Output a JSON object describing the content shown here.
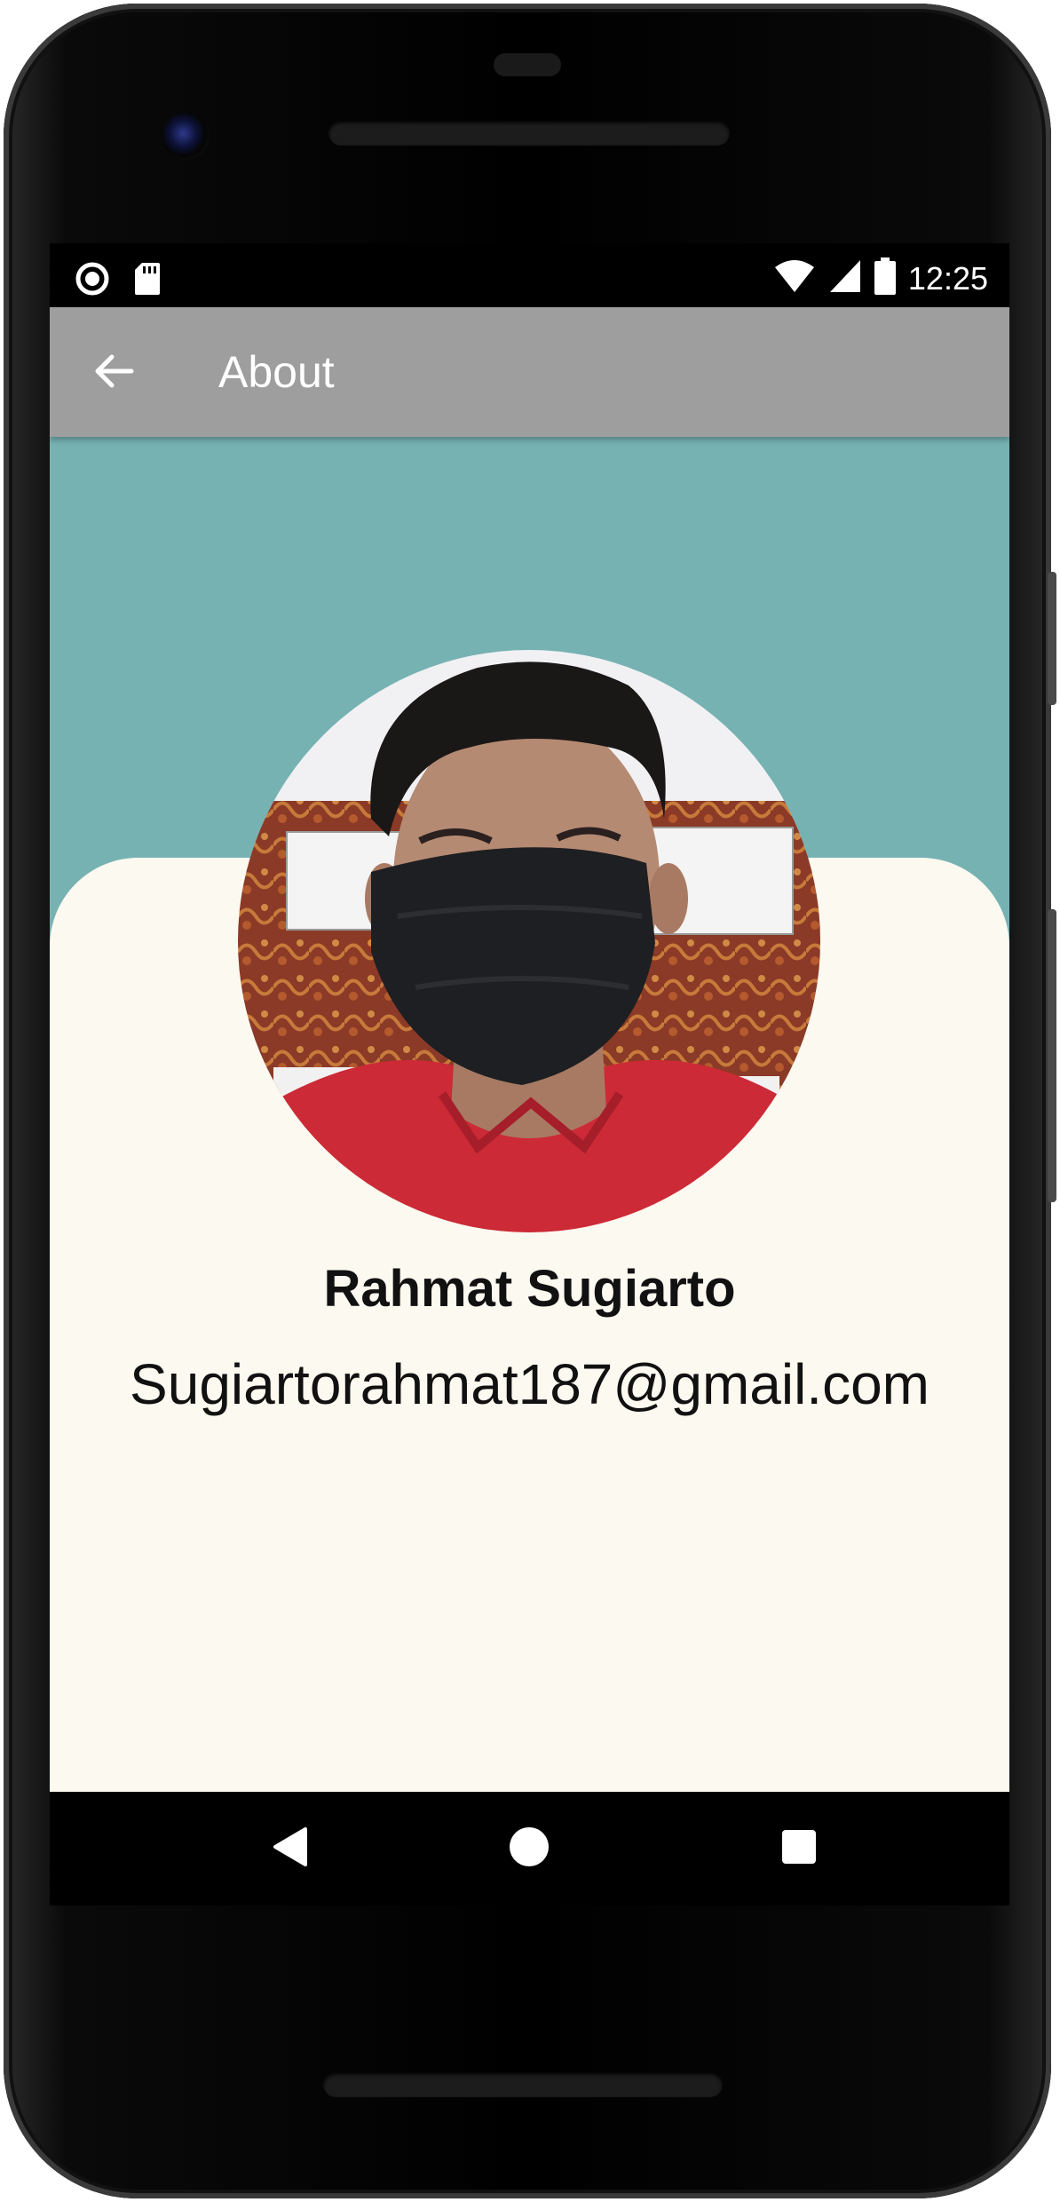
{
  "status_bar": {
    "time": "12:25",
    "left_icons": [
      "record-icon",
      "sd-card-icon"
    ],
    "right_icons": [
      "wifi-icon",
      "cell-signal-icon",
      "battery-icon"
    ]
  },
  "toolbar": {
    "title": "About",
    "back_icon": "arrow-back-icon",
    "background": "#9e9e9e"
  },
  "profile": {
    "name": "Rahmat Sugiarto",
    "email": "Sugiartorahmat187@gmail.com",
    "avatar_icon": "profile-photo"
  },
  "colors": {
    "header_teal": "#77b2b3",
    "card_background": "#fcf9f0"
  },
  "nav_bar": {
    "buttons": [
      "back-triangle-icon",
      "home-circle-icon",
      "recents-square-icon"
    ]
  }
}
